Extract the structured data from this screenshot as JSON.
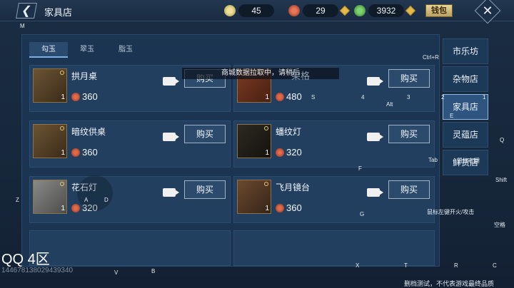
{
  "header": {
    "title": "家具店",
    "back_label": "❮",
    "close_label": "✕",
    "wallet_label": "钱包",
    "currencies": [
      {
        "name": "copper-coin",
        "value": "45",
        "color": "#d9c46a"
      },
      {
        "name": "red-jade",
        "value": "29",
        "color": "#c9533a"
      },
      {
        "name": "green-jade",
        "value": "3932",
        "color": "#4fae4a"
      }
    ]
  },
  "tabs": [
    {
      "label": "勾玉",
      "active": true
    },
    {
      "label": "翠玉",
      "active": false
    },
    {
      "label": "脂玉",
      "active": false
    }
  ],
  "items": [
    {
      "name": "拱月桌",
      "qty": "1",
      "price": "360",
      "buy": "购买"
    },
    {
      "name": "",
      "qty": "1",
      "price": "480",
      "buy": "购买"
    },
    {
      "name": "暗纹供桌",
      "qty": "1",
      "price": "360",
      "buy": "购买"
    },
    {
      "name": "蟠纹灯",
      "qty": "1",
      "price": "320",
      "buy": "购买"
    },
    {
      "name": "花石灯",
      "qty": "1",
      "price": "320",
      "buy": "购买"
    },
    {
      "name": "飞月镜台",
      "qty": "1",
      "price": "360",
      "buy": "购买"
    }
  ],
  "sidebar": [
    {
      "label": "市乐坊",
      "active": false
    },
    {
      "label": "杂物店",
      "active": false
    },
    {
      "label": "家具店",
      "active": true
    },
    {
      "label": "灵蕴店",
      "active": false
    },
    {
      "label": "鲜货店",
      "active": false
    }
  ],
  "toast": "商城数据拉取中，请稍后",
  "ghost_text": "架格",
  "overlay": {
    "qq": "QQ 4区",
    "uid": "1446781380294393​40",
    "footnote": "删档测试，不代表游戏最终品质",
    "keys": [
      "M",
      "Ctrl+R",
      "Alt",
      "Tab",
      "Shift",
      "Z",
      "V",
      "B",
      "X",
      "T",
      "R",
      "C",
      "4",
      "3",
      "2",
      "1",
      "S",
      "F",
      "G",
      "E",
      "Q",
      "A",
      "D",
      "空格",
      "鼠标左键开火/攻击",
      "鼠标右键"
    ]
  }
}
